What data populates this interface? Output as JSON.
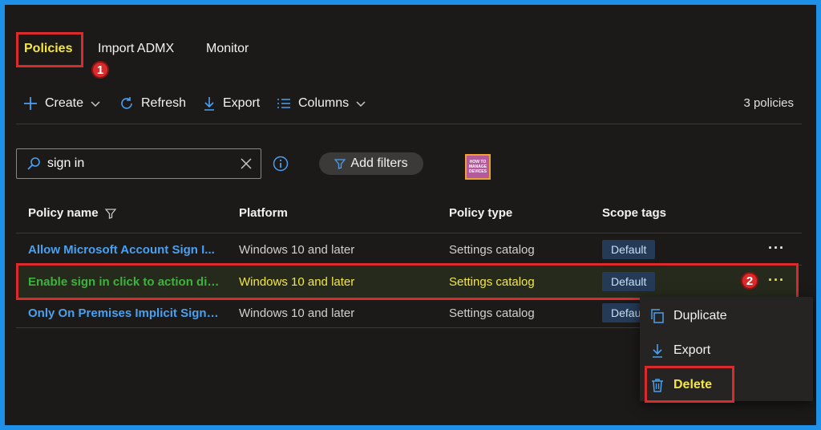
{
  "tabs": [
    {
      "label": "Policies",
      "active": true
    },
    {
      "label": "Import ADMX",
      "active": false
    },
    {
      "label": "Monitor",
      "active": false
    }
  ],
  "annotations": {
    "step1": "1",
    "step2": "2"
  },
  "toolbar": {
    "create_label": "Create",
    "refresh_label": "Refresh",
    "export_label": "Export",
    "columns_label": "Columns",
    "count_text": "3 policies"
  },
  "search": {
    "value": "sign in"
  },
  "filters": {
    "add_label": "Add filters"
  },
  "logo": {
    "line1": "HOW TO",
    "line2": "MANAGE",
    "line3": "DEVICES"
  },
  "table": {
    "headers": {
      "name": "Policy name",
      "platform": "Platform",
      "type": "Policy type",
      "scope": "Scope tags"
    },
    "rows": [
      {
        "name": "Allow Microsoft Account Sign I...",
        "platform": "Windows 10 and later",
        "type": "Settings catalog",
        "scope": "Default"
      },
      {
        "name": "Enable sign in click to action dia...",
        "platform": "Windows 10 and later",
        "type": "Settings catalog",
        "scope": "Default"
      },
      {
        "name": "Only On Premises Implicit Sign i...",
        "platform": "Windows 10 and later",
        "type": "Settings catalog",
        "scope": "Defau"
      }
    ],
    "more_glyph": "···"
  },
  "context_menu": {
    "duplicate_label": "Duplicate",
    "export_label": "Export",
    "delete_label": "Delete"
  },
  "colors": {
    "accent": "#4aa0f0",
    "highlight_text": "#f5e642",
    "annotation_red": "#d92b2b",
    "selected_row_text": "#3cb43c",
    "background": "#1b1a19"
  }
}
